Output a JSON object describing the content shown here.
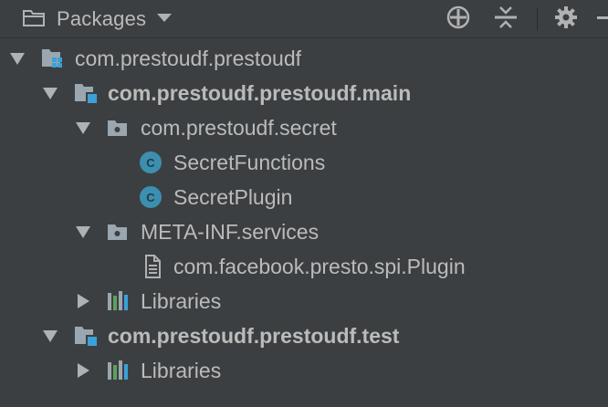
{
  "toolbar": {
    "view_title": "Packages",
    "icons": [
      "folder-icon",
      "dropdown-arrow-icon",
      "locate-icon",
      "collapse-all-icon",
      "settings-icon",
      "hide-icon"
    ]
  },
  "tree": {
    "root": {
      "label": "com.prestoudf.prestoudf",
      "icon": "module-icon"
    },
    "main": {
      "label": "com.prestoudf.prestoudf.main",
      "icon": "source-module-icon",
      "secret_package": {
        "label": "com.prestoudf.secret",
        "icon": "package-icon",
        "classes": [
          "SecretFunctions",
          "SecretPlugin"
        ],
        "class_badge": "C"
      },
      "meta_inf": {
        "label": "META-INF.services",
        "icon": "package-icon",
        "file": "com.facebook.presto.spi.Plugin"
      },
      "libraries": "Libraries"
    },
    "test": {
      "label": "com.prestoudf.prestoudf.test",
      "icon": "source-module-icon",
      "libraries": "Libraries"
    }
  },
  "colors": {
    "background": "#3c3f41",
    "text": "#bbbbbb",
    "class_badge": "#3d8fb0",
    "source_accent": "#3ba1d8",
    "library_green": "#5f9f5f"
  }
}
